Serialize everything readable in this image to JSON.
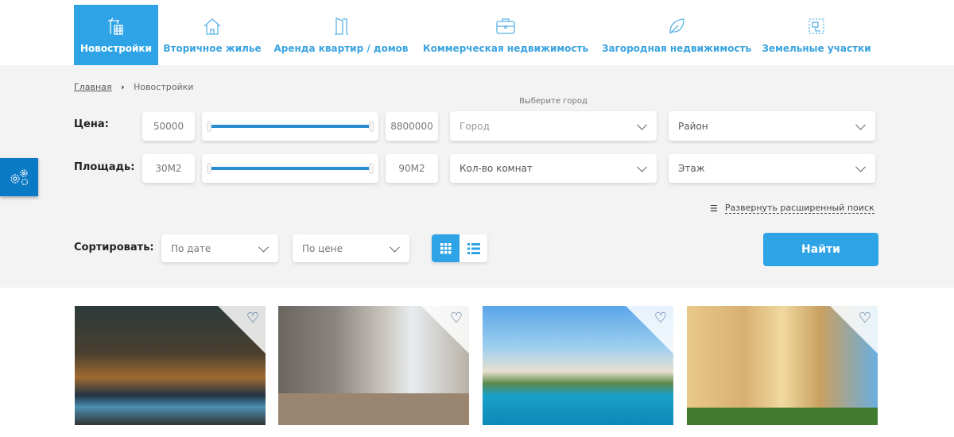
{
  "nav": [
    {
      "label": "Новостройки",
      "icon": "crane-building-icon",
      "active": true
    },
    {
      "label": "Вторичное жилье",
      "icon": "house-icon"
    },
    {
      "label": "Аренда квартир / домов",
      "icon": "door-icon"
    },
    {
      "label": "Коммерческая недвижимость",
      "icon": "briefcase-icon"
    },
    {
      "label": "Загородная недвижимость",
      "icon": "leaf-icon"
    },
    {
      "label": "Земельные участки",
      "icon": "land-plot-icon"
    }
  ],
  "breadcrumb": {
    "home": "Главная",
    "current": "Новостройки"
  },
  "filters": {
    "price_label": "Цена:",
    "price_min": "50000",
    "price_max": "8800000",
    "area_label": "Площадь:",
    "area_min": "30М2",
    "area_max": "90М2",
    "city_hint": "Выберите город",
    "city": "Город",
    "district": "Район",
    "rooms": "Кол-во комнат",
    "floor": "Этаж",
    "advanced": "Развернуть расширенный поиск",
    "sort_label": "Сортировать:",
    "sort_date": "По дате",
    "sort_price": "По цене",
    "find": "Найти"
  },
  "accent": "#2ea4e6",
  "listings": [
    {
      "image": "modern house at night with pool"
    },
    {
      "image": "empty apartment room"
    },
    {
      "image": "villa with pool"
    },
    {
      "image": "high-rise residential buildings"
    }
  ]
}
